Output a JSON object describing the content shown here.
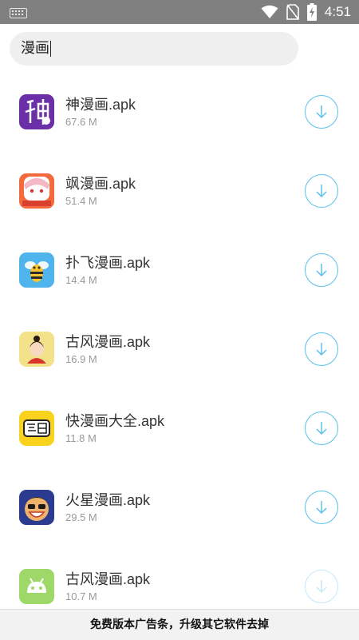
{
  "status_bar": {
    "time": "4:51",
    "icons": [
      "keyboard-icon",
      "wifi-icon",
      "no-sim-icon",
      "battery-charging-icon"
    ]
  },
  "search": {
    "query": "漫画"
  },
  "files": [
    {
      "name": "神漫画.apk",
      "size": "67.6 M",
      "icon": "shen-manhua-app-icon",
      "color": "#6b2fa8"
    },
    {
      "name": "飒漫画.apk",
      "size": "51.4 M",
      "icon": "sa-manhua-app-icon",
      "color": "#f26a3d"
    },
    {
      "name": "扑飞漫画.apk",
      "size": "14.4 M",
      "icon": "pufei-manhua-app-icon",
      "color": "#4fb3ec"
    },
    {
      "name": "古风漫画.apk",
      "size": "16.9 M",
      "icon": "gufeng-manhua-app-icon",
      "color": "#f3e28a"
    },
    {
      "name": "快漫画大全.apk",
      "size": "11.8 M",
      "icon": "kuai-manhua-app-icon",
      "color": "#f8d21c"
    },
    {
      "name": "火星漫画.apk",
      "size": "29.5 M",
      "icon": "huoxing-manhua-app-icon",
      "color": "#2b3b8f"
    },
    {
      "name": "古风漫画.apk",
      "size": "10.7 M",
      "icon": "android-app-icon",
      "color": "#9dd868"
    }
  ],
  "download_icon": "download-arrow-icon",
  "accent_color": "#5bc0ea",
  "ad_banner": {
    "text": "免费版本广告条，升级其它软件去掉"
  }
}
